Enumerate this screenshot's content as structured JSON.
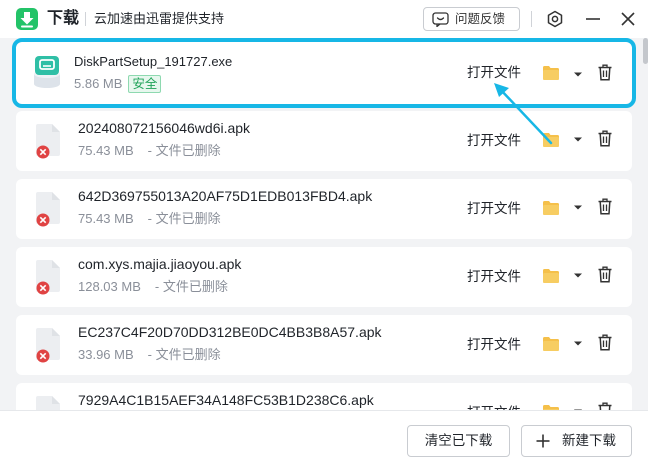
{
  "app": {
    "title": "下载",
    "subtitle": "云加速由迅雷提供支持",
    "feedback_label": "问题反馈"
  },
  "colors": {
    "brand_green": "#23c368",
    "highlight_blue": "#17b7e6",
    "folder_yellow": "#f5c04a",
    "error_red": "#e04343"
  },
  "icons": {
    "logo": "download-app-icon",
    "feedback": "chat-bubble-icon",
    "settings": "gear-icon",
    "minimize": "minimize-icon",
    "close": "close-icon",
    "folder": "folder-icon",
    "chevron": "chevron-down-icon",
    "delete": "trash-icon",
    "add": "plus-icon"
  },
  "actions": {
    "open_file": "打开文件"
  },
  "downloads": [
    {
      "name": "DiskPartSetup_191727.exe",
      "size": "5.86 MB",
      "status": "安全",
      "deleted": ""
    },
    {
      "name": "202408072156046wd6i.apk",
      "size": "75.43 MB",
      "status": "",
      "deleted": "- 文件已删除"
    },
    {
      "name": "642D369755013A20AF75D1EDB013FBD4.apk",
      "size": "75.43 MB",
      "status": "",
      "deleted": "- 文件已删除"
    },
    {
      "name": "com.xys.majia.jiaoyou.apk",
      "size": "128.03 MB",
      "status": "",
      "deleted": "- 文件已删除"
    },
    {
      "name": "EC237C4F20D70DD312BE0DC4BB3B8A57.apk",
      "size": "33.96 MB",
      "status": "",
      "deleted": "- 文件已删除"
    },
    {
      "name": "7929A4C1B15AEF34A148FC53B1D238C6.apk",
      "size": "",
      "status": "",
      "deleted": ""
    }
  ],
  "footer": {
    "clear_label": "清空已下载",
    "new_label": "新建下载"
  }
}
